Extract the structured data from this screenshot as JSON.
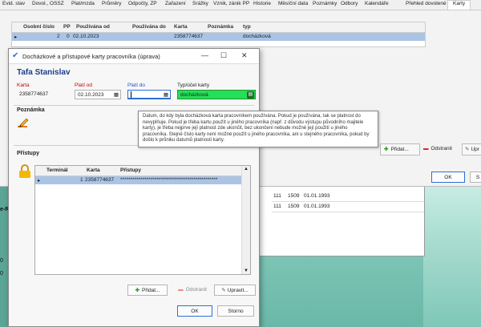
{
  "main": {
    "tabs": [
      "Evid. stav",
      "Dovol., OSSZ",
      "Plat/mzda",
      "Průměry",
      "Odpočty, ZP",
      "Zařazení",
      "Srážky",
      "Vznik, zánik PP",
      "Historie",
      "Měsíční data",
      "Poznámky",
      "Odbory",
      "Kalendáře",
      "Přehled dovolené",
      "Karty"
    ],
    "grid": {
      "columns": [
        "Osobní číslo",
        "PP",
        "Používána od",
        "Používána do",
        "Karta",
        "Poznámka",
        "typ"
      ],
      "row": {
        "osobni": "2",
        "pp": "0",
        "od": "02.10.2023",
        "do": "",
        "karta": "2358774637",
        "poznamka": "",
        "typ": "docházková"
      }
    },
    "buttons": {
      "add": "Přidat...",
      "remove": "Odstranit",
      "edit": "Upr",
      "ok": "OK",
      "cancel": "S"
    }
  },
  "back": {
    "rows": [
      {
        "a": "111",
        "b": "1509",
        "c": "01.01.1993"
      },
      {
        "a": "111",
        "b": "1509",
        "c": "01.01.1993"
      }
    ]
  },
  "left_labels": [
    "e-R",
    "0",
    "0"
  ],
  "dialog": {
    "title": "Docházkové a přístupové karty pracovníka (úprava)",
    "name": "Tafa Stanislav",
    "karta_label": "Karta",
    "karta_value": "2358774637",
    "plati_od_label": "Platí od",
    "plati_od_value": "02.10.2023",
    "plati_do_label": "Platí do",
    "plati_do_value": "",
    "typ_label": "Typ/účel karty",
    "typ_value": "docházková",
    "poznamka_label": "Poznámka",
    "tooltip": "Datum, do kdy byla docházková karta pracovníkem používána. Pokud je používána, tak se platnost do nevyplňuje. Pokud je třeba kartu použít u jiného pracovníka (např. z důvodu výstupu původního majitele karty), je třeba nejprve její platnost zde ukončit, bez ukončení nebude možné její použití u jiného pracovníka. Stejné číslo karty není možné použít u jiného pracovníka, ani u stejného pracovníka, pokud by došlo k průniku datumů platnosti karty.",
    "pristupy_label": "Přístupy",
    "pgrid": {
      "columns": [
        "Terminál",
        "Karta",
        "Přístupy"
      ],
      "row": {
        "terminal": "1",
        "karta": "2358774637",
        "pristupy": "************************************************"
      }
    },
    "buttons": {
      "add": "Přidat...",
      "remove": "Odstranit",
      "edit": "Upravit...",
      "ok": "OK",
      "cancel": "Storno"
    }
  },
  "colors": {
    "accent": "#1b3f8b",
    "selected_row": "#aac4e6",
    "typ_field": "#22e05a"
  }
}
